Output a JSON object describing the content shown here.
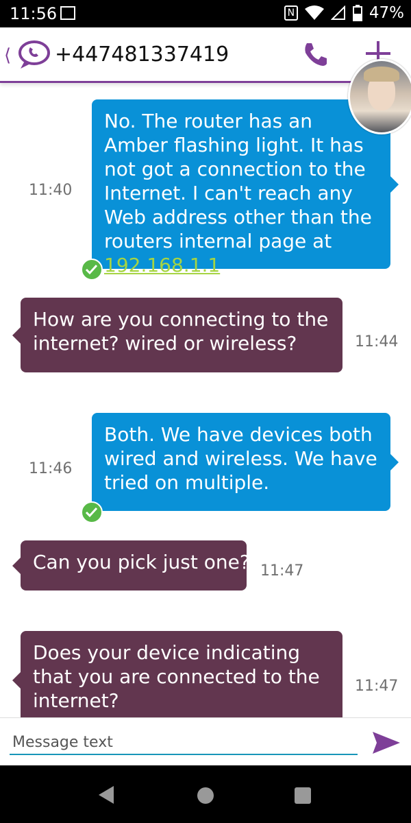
{
  "status_bar": {
    "time": "11:56",
    "battery": "47%"
  },
  "header": {
    "contact": "+447481337419"
  },
  "messages": [
    {
      "direction": "out",
      "text": "No. The router has an Amber flashing light. It has not got a connection to the Internet. I can't reach any Web address other than the routers internal page at ",
      "link": "192.168.1.1",
      "tail": ".",
      "time": "11:40",
      "delivered": true
    },
    {
      "direction": "in",
      "text": "How are you connecting to the internet? wired or wireless?",
      "time": "11:44"
    },
    {
      "direction": "out",
      "text": "Both. We have devices both wired and wireless. We have tried on multiple.",
      "time": "11:46",
      "delivered": true
    },
    {
      "direction": "in",
      "text": "Can you pick just one?",
      "time": "11:47"
    },
    {
      "direction": "in",
      "text": "Does your device indicating that you are connected to the internet?",
      "time": "11:47"
    }
  ],
  "composer": {
    "placeholder": "Message text",
    "value": ""
  },
  "colors": {
    "brand_purple": "#7e3f98",
    "outgoing_bubble": "#0991d7",
    "incoming_bubble": "#62364f",
    "delivered_check": "#58b947",
    "link": "#a6d443"
  },
  "icons": [
    "app-logo-icon",
    "phone-icon",
    "add-icon",
    "send-icon",
    "delivered-check-icon",
    "nav-back-icon",
    "nav-home-icon",
    "nav-recents-icon"
  ]
}
